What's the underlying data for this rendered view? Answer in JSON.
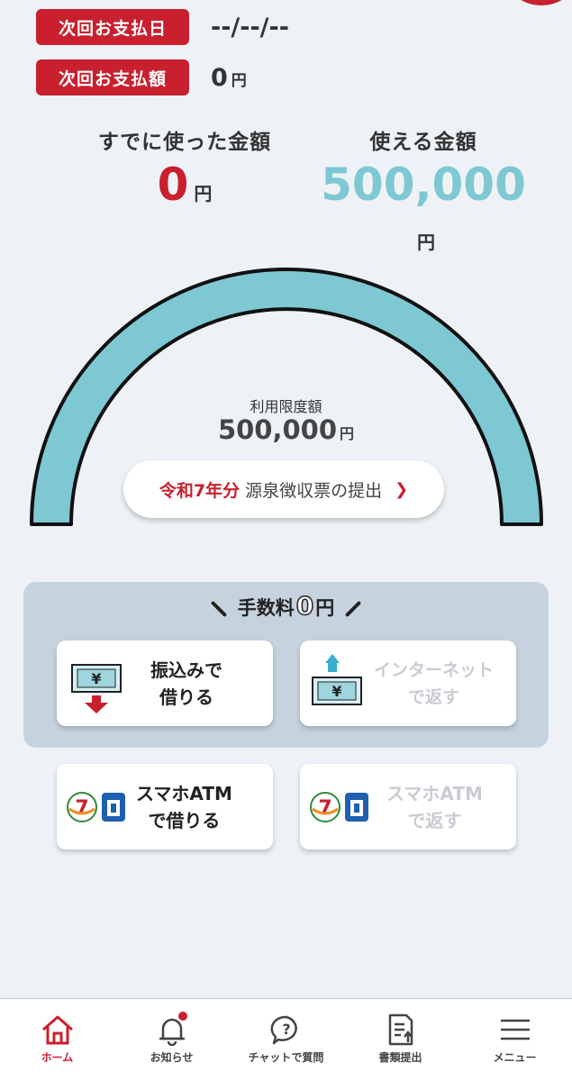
{
  "payment": {
    "next_date_label": "次回お支払日",
    "next_date_value": "--/--/--",
    "next_amount_label": "次回お支払額",
    "next_amount_value": "0",
    "yen": "円"
  },
  "summary": {
    "used_label": "すでに使った金額",
    "used_value": "0",
    "available_label": "使える金額",
    "available_value": "500,000",
    "yen": "円"
  },
  "gauge": {
    "limit_label": "利用限度額",
    "limit_value": "500,000",
    "yen": "円",
    "used_fraction": 0
  },
  "tax_button": {
    "year": "令和7年分",
    "text": "源泉徴収票の提出",
    "chevron": "›"
  },
  "fee_banner": {
    "prefix": "手数料",
    "zero": "0",
    "yen": "円"
  },
  "actions": {
    "transfer_borrow": {
      "line1": "振込みで",
      "line2": "借りる"
    },
    "internet_repay": {
      "line1": "インターネット",
      "line2": "で返す"
    },
    "atm_borrow": {
      "line1": "スマホATM",
      "line2": "で借りる"
    },
    "atm_repay": {
      "line1": "スマホATM",
      "line2": "で返す"
    }
  },
  "tabs": [
    {
      "label": "ホーム",
      "icon": "home-icon",
      "active": true
    },
    {
      "label": "お知らせ",
      "icon": "bell-icon"
    },
    {
      "label": "チャットで質問",
      "icon": "chat-question-icon"
    },
    {
      "label": "書類提出",
      "icon": "document-upload-icon"
    },
    {
      "label": "メニュー",
      "icon": "hamburger-menu-icon"
    }
  ],
  "colors": {
    "brand_red": "#c8202f",
    "available_teal": "#7ec8d4",
    "gauge_fill": "#7ec8d4",
    "fee_panel": "#c6d3df"
  }
}
